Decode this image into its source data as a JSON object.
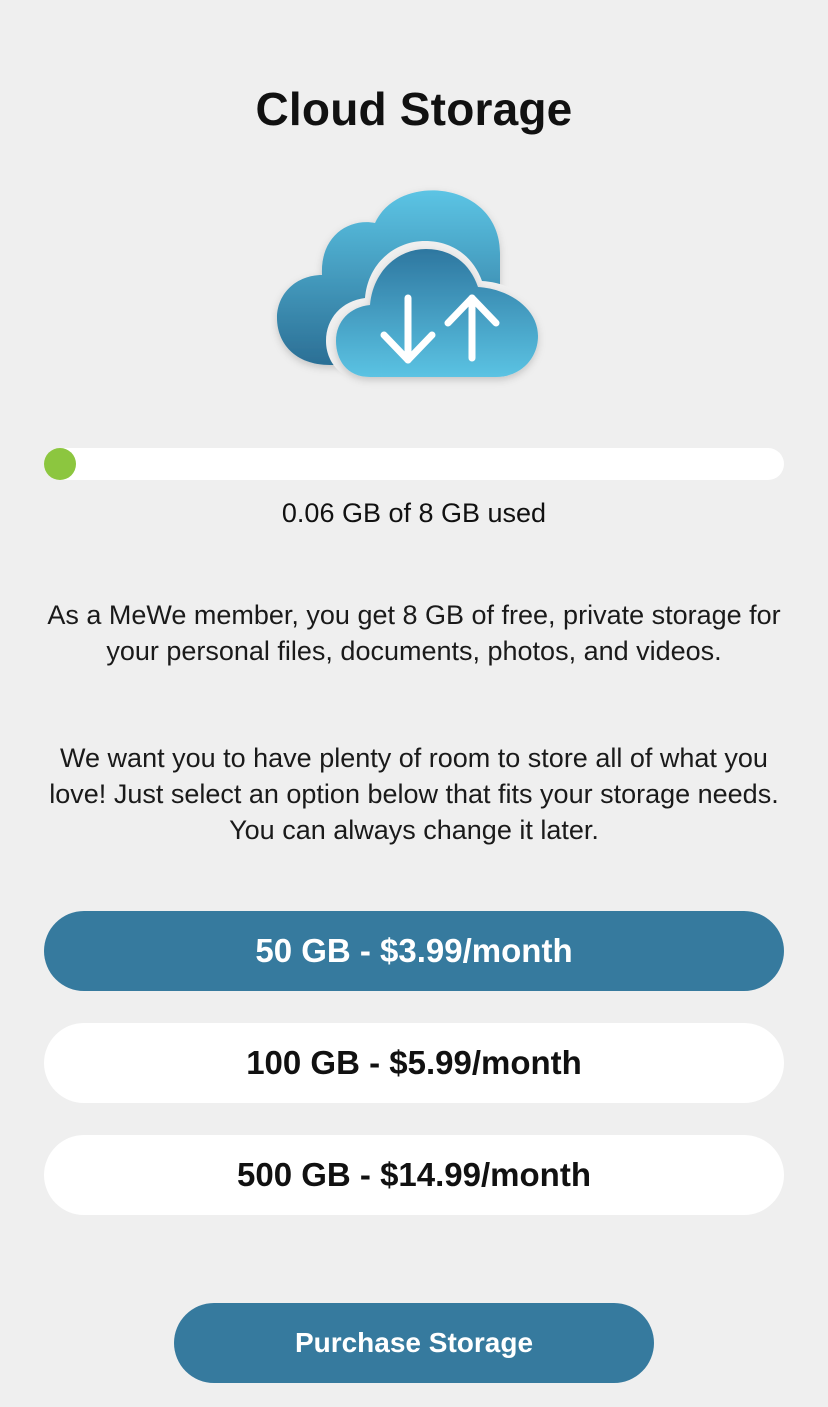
{
  "header": {
    "title": "Cloud Storage"
  },
  "illustration": {
    "icon": "cloud-upload-download-icon",
    "colors": {
      "back_cloud": "#4fb3d8",
      "front_cloud": "#3b8fb5",
      "arrows": "#ffffff"
    }
  },
  "usage": {
    "used_fraction": 0.0075,
    "text": "0.06 GB of 8 GB used",
    "bar_color": "#8cc63f",
    "track_color": "#ffffff"
  },
  "description": {
    "paragraph_1": "As a MeWe member, you get 8 GB of free, private storage for your personal files, documents, photos, and videos.",
    "paragraph_2": "We want you to have plenty of room to store all of what you love! Just select an option below that fits your storage needs. You can always change it later."
  },
  "plans": [
    {
      "label": "50 GB - $3.99/month",
      "selected": true
    },
    {
      "label": "100 GB - $5.99/month",
      "selected": false
    },
    {
      "label": "500 GB - $14.99/month",
      "selected": false
    }
  ],
  "actions": {
    "purchase_label": "Purchase Storage"
  },
  "colors": {
    "accent": "#367a9e",
    "background": "#efefef"
  }
}
